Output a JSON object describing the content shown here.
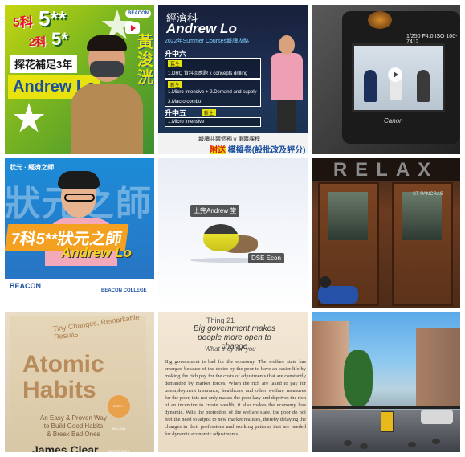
{
  "tiles": {
    "t1": {
      "line1_small": "5科",
      "line1_big": "5**",
      "line2_small": "2科",
      "line2_big": "5*",
      "tagline": "探花補足3年",
      "name": "Andrew Lo",
      "side_text": "黃浚洸",
      "logo": "BEACON"
    },
    "t2": {
      "econ": "經濟科",
      "name": "Andrew Lo",
      "summer": "2022年Summer Courses報讀攻略",
      "f6_heading": "升中六",
      "f6_pill": "舊生",
      "f6_line": "1.DRQ 資料回應題 x concepts drilling",
      "f6_pill2": "新生",
      "f6_line2a": "1.Micro Intensive + 2.Demand and supply +",
      "f6_line2b": "3.Macro combo",
      "f5_heading": "升中五",
      "f5_pill": "新生",
      "f5_line": "1.Micro Intensive",
      "bottom_small": "報讀共兩個獨立重兩課程",
      "bottom_highlight": "附送",
      "bottom_big": "模擬卷(設批改及評分)"
    },
    "t3": {
      "screen_label": "1/250 F4.0 ISO 100-7412",
      "brand": "Canon"
    },
    "t4": {
      "top_label": "狀元 · 經濟之師",
      "bg_text": "狀元之師",
      "banner": "7科5**狀元之師",
      "name": "Andrew Lo",
      "logo": "BEACON",
      "logo2": "BEACON COLLEGE"
    },
    "t5": {
      "label1": "上完Andrew 堂",
      "label2": "DSE Econ"
    },
    "t6": {
      "sign": "RELAX",
      "pancras": "ST PANCRAS"
    },
    "t7": {
      "subtitle": "Tiny Changes, Remarkable Results",
      "title_line1": "Atomic",
      "title_line2": "Habits",
      "desc_line1": "An Easy & Proven Way",
      "desc_line2": "to Build Good Habits",
      "desc_line3": "& Break Bad Ones",
      "seal": "OVER 1 MILLION COPIES SOLD",
      "author": "James Clear"
    },
    "t8": {
      "thing": "Thing 21",
      "title": "Big government makes people more open to change",
      "what": "What they tell you",
      "body": "Big government is bad for the economy. The welfare state has emerged because of the desire by the poor to have an easier life by making the rich pay for the costs of adjustments that are constantly demanded by market forces. When the rich are taxed to pay for unemployment insurance, healthcare and other welfare measures for the poor, this not only makes the poor lazy and deprives the rich of an incentive to create wealth, it also makes the economy less dynamic. With the protection of the welfare state, the poor do not feel the need to adjust to new market realities, thereby delaying the changes in their professions and working patterns that are needed for dynamic economic adjustments."
    }
  },
  "colors": {
    "accent_yellow": "#e8e30f",
    "accent_red": "#e8142a",
    "brand_blue": "#1b4f9e"
  }
}
